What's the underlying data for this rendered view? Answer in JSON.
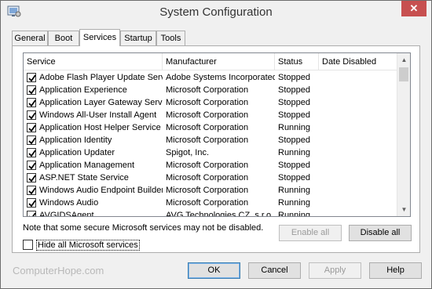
{
  "window": {
    "title": "System Configuration",
    "close_glyph": "✕"
  },
  "tabs": [
    {
      "label": "General",
      "active": false
    },
    {
      "label": "Boot",
      "active": false
    },
    {
      "label": "Services",
      "active": true
    },
    {
      "label": "Startup",
      "active": false
    },
    {
      "label": "Tools",
      "active": false
    }
  ],
  "services": {
    "columns": {
      "service": "Service",
      "manufacturer": "Manufacturer",
      "status": "Status",
      "date_disabled": "Date Disabled"
    },
    "rows": [
      {
        "checked": true,
        "service": "Adobe Flash Player Update Service",
        "manufacturer": "Adobe Systems Incorporated",
        "status": "Stopped",
        "date_disabled": ""
      },
      {
        "checked": true,
        "service": "Application Experience",
        "manufacturer": "Microsoft Corporation",
        "status": "Stopped",
        "date_disabled": ""
      },
      {
        "checked": true,
        "service": "Application Layer Gateway Service",
        "manufacturer": "Microsoft Corporation",
        "status": "Stopped",
        "date_disabled": ""
      },
      {
        "checked": true,
        "service": "Windows All-User Install Agent",
        "manufacturer": "Microsoft Corporation",
        "status": "Stopped",
        "date_disabled": ""
      },
      {
        "checked": true,
        "service": "Application Host Helper Service",
        "manufacturer": "Microsoft Corporation",
        "status": "Running",
        "date_disabled": ""
      },
      {
        "checked": true,
        "service": "Application Identity",
        "manufacturer": "Microsoft Corporation",
        "status": "Stopped",
        "date_disabled": ""
      },
      {
        "checked": true,
        "service": "Application Updater",
        "manufacturer": "Spigot, Inc.",
        "status": "Running",
        "date_disabled": ""
      },
      {
        "checked": true,
        "service": "Application Management",
        "manufacturer": "Microsoft Corporation",
        "status": "Stopped",
        "date_disabled": ""
      },
      {
        "checked": true,
        "service": "ASP.NET State Service",
        "manufacturer": "Microsoft Corporation",
        "status": "Stopped",
        "date_disabled": ""
      },
      {
        "checked": true,
        "service": "Windows Audio Endpoint Builder",
        "manufacturer": "Microsoft Corporation",
        "status": "Running",
        "date_disabled": ""
      },
      {
        "checked": true,
        "service": "Windows Audio",
        "manufacturer": "Microsoft Corporation",
        "status": "Running",
        "date_disabled": ""
      },
      {
        "checked": true,
        "service": "AVGIDSAgent",
        "manufacturer": "AVG Technologies CZ, s.r.o.",
        "status": "Running",
        "date_disabled": ""
      }
    ]
  },
  "note": "Note that some secure Microsoft services may not be disabled.",
  "buttons": {
    "enable_all": "Enable all",
    "disable_all": "Disable all",
    "ok": "OK",
    "cancel": "Cancel",
    "apply": "Apply",
    "help": "Help"
  },
  "hide_ms": {
    "label": "Hide all Microsoft services",
    "checked": false
  },
  "watermark": "ComputerHope.com",
  "colors": {
    "close_button": "#c75050",
    "window_bg": "#f0f0f0",
    "default_button_border": "#3c7fb1"
  }
}
